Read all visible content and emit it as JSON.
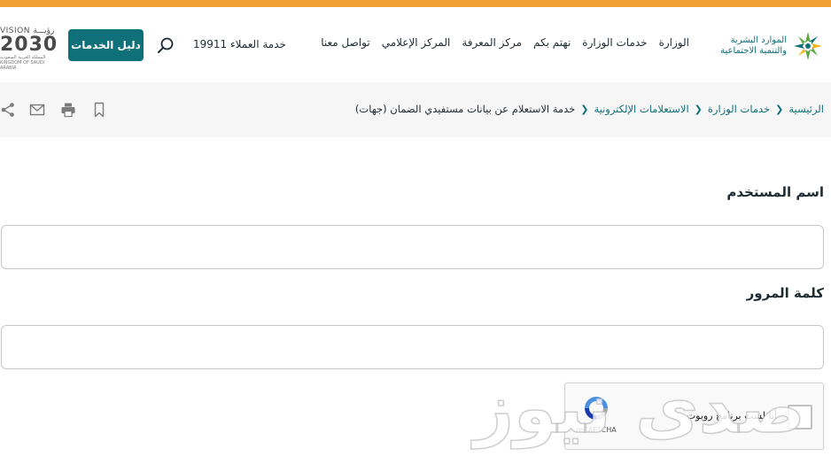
{
  "colors": {
    "accent_orange": "#f0a030",
    "brand_teal": "#10707a",
    "logo_green": "#5aa843",
    "logo_yellow": "#f3b31a"
  },
  "header": {
    "logo_line1": "الموارد البشرية",
    "logo_line2": "والتنمية الاجتماعية",
    "nav": [
      "الوزارة",
      "خدمات الوزارة",
      "نهتم بكم",
      "مركز المعرفة",
      "المركز الإعلامي",
      "تواصل معنا"
    ],
    "hotline": "خدمة العملاء 19911",
    "search_icon": "search-icon",
    "guide_button": "دليل الخدمات",
    "vision": {
      "label": "VISION رؤيـــة",
      "year": "2030",
      "subtitle": "المملكة العربية السعودية KINGDOM OF SAUDI ARABIA"
    }
  },
  "breadcrumb": {
    "items": [
      "الرئيسية",
      "خدمات الوزارة",
      "الاستعلامات الإلكترونية"
    ],
    "current": "خدمة الاستعلام عن بيانات مستفيدي الضمان (جهات)",
    "tools": [
      "bookmark-icon",
      "print-icon",
      "mail-icon",
      "share-icon"
    ]
  },
  "form": {
    "username_label": "اسم المستخدم",
    "username_value": "",
    "password_label": "كلمة المرور",
    "password_value": ""
  },
  "captcha": {
    "text": "أنا لست برنامج روبوت",
    "brand": "reCAPTCHA"
  },
  "watermark": "صدى نيوز"
}
